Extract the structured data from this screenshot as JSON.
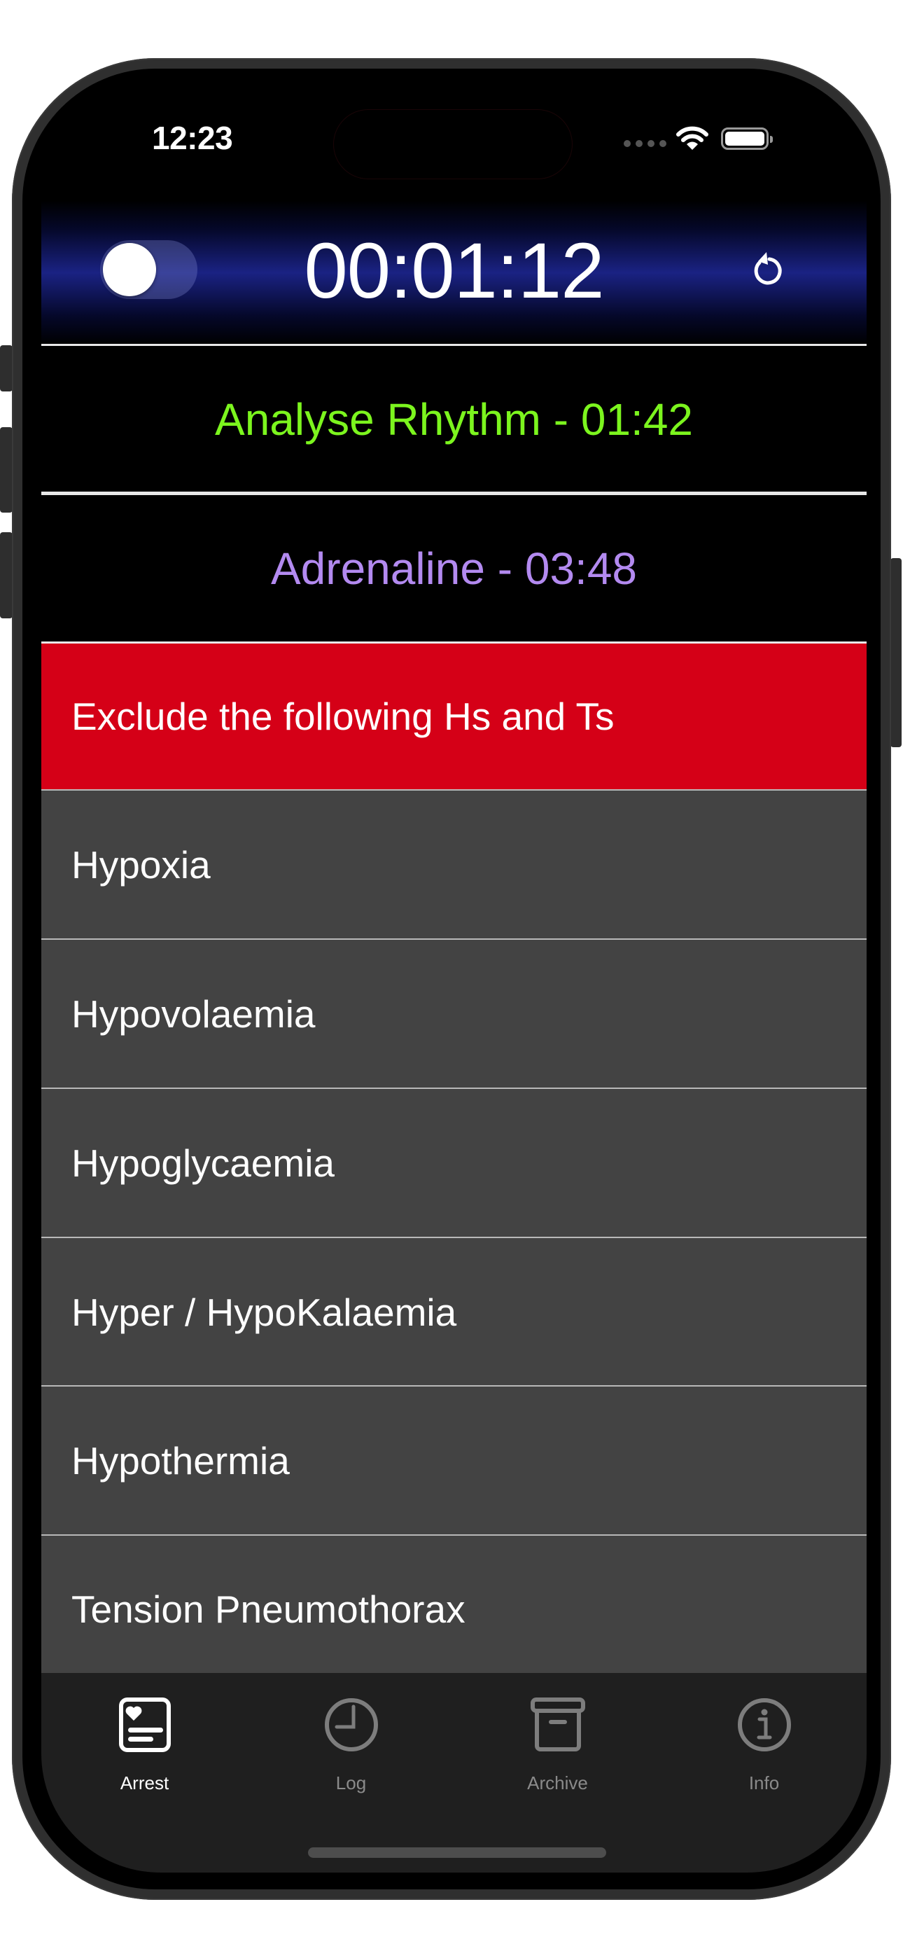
{
  "status_bar": {
    "time": "12:23",
    "signal_icon": "cellular-signal-dots-icon",
    "wifi_icon": "wifi-icon",
    "battery_icon": "battery-full-icon"
  },
  "header": {
    "toggle": {
      "state": "off",
      "icon": "toggle-switch"
    },
    "timer": "00:01:12",
    "reset_icon": "reset-arrow-icon"
  },
  "banners": [
    {
      "text": "Analyse Rhythm - 01:42",
      "color": "#7cf51e"
    },
    {
      "text": "Adrenaline - 03:48",
      "color": "#b38af0"
    }
  ],
  "list": {
    "header": "Exclude the following Hs and Ts",
    "header_color": "#d50017",
    "items": [
      "Hypoxia",
      "Hypovolaemia",
      "Hypoglycaemia",
      "Hyper / HypoKalaemia",
      "Hypothermia",
      "Tension Pneumothorax"
    ]
  },
  "tabbar": {
    "active_color": "#ffffff",
    "inactive_color": "#8a8a8a",
    "tabs": [
      {
        "label": "Arrest",
        "icon": "heart-card-icon",
        "active": true
      },
      {
        "label": "Log",
        "icon": "clock-icon",
        "active": false
      },
      {
        "label": "Archive",
        "icon": "archive-box-icon",
        "active": false
      },
      {
        "label": "Info",
        "icon": "info-circle-icon",
        "active": false
      }
    ]
  }
}
